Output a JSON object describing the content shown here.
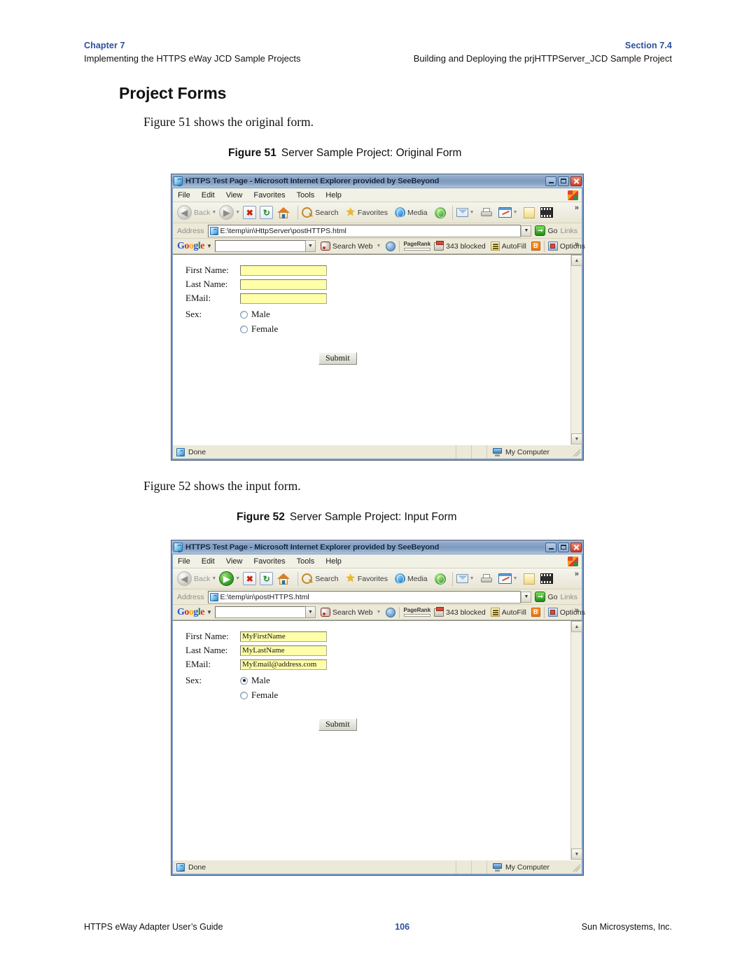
{
  "header": {
    "left_top": "Chapter 7",
    "left_sub": "Implementing the HTTPS eWay JCD Sample Projects",
    "right_top": "Section 7.4",
    "right_sub": "Building and Deploying the prjHTTPServer_JCD Sample Project",
    "accent_color": "#2a4f9e"
  },
  "section": {
    "title": "Project Forms",
    "para1": "Figure 51 shows the original form.",
    "para2": "Figure 52 shows the input form."
  },
  "figure51": {
    "caption_label": "Figure 51",
    "caption_text": "Server Sample Project: Original Form",
    "window": {
      "title": "HTTPS Test Page - Microsoft Internet Explorer provided by SeeBeyond",
      "minimize": "–",
      "maximize": "❐",
      "close": "✕",
      "menu": [
        "File",
        "Edit",
        "View",
        "Favorites",
        "Tools",
        "Help"
      ],
      "toolbar": {
        "back": "Back",
        "search": "Search",
        "favorites": "Favorites",
        "media": "Media",
        "overflow": "»"
      },
      "address": {
        "label": "Address",
        "value": "E:\\temp\\in\\HttpServer\\postHTTPS.html",
        "go": "Go",
        "links": "Links"
      },
      "google": {
        "logo": "Google",
        "query": "",
        "search_web": "Search Web",
        "pagerank": "PageRank",
        "blocked": "343 blocked",
        "autofill": "AutoFill",
        "b_button": "B",
        "options": "Options",
        "overflow": "»"
      },
      "status": {
        "text": "Done",
        "zone": "My Computer"
      }
    },
    "form": {
      "first_name_label": "First Name:",
      "first_name_value": "",
      "last_name_label": "Last Name:",
      "last_name_value": "",
      "email_label": "EMail:",
      "email_value": "",
      "sex_label": "Sex:",
      "male_label": "Male",
      "female_label": "Female",
      "male_checked": false,
      "female_checked": false,
      "submit_label": "Submit",
      "field_color": "#ffffaa"
    }
  },
  "figure52": {
    "caption_label": "Figure 52",
    "caption_text": "Server Sample Project: Input Form",
    "window": {
      "title": "HTTPS Test Page - Microsoft Internet Explorer provided by SeeBeyond",
      "menu": [
        "File",
        "Edit",
        "View",
        "Favorites",
        "Tools",
        "Help"
      ],
      "toolbar": {
        "back": "Back",
        "search": "Search",
        "favorites": "Favorites",
        "media": "Media",
        "overflow": "»"
      },
      "address": {
        "label": "Address",
        "value": "E:\\temp\\in\\postHTTPS.html",
        "go": "Go",
        "links": "Links"
      },
      "google": {
        "logo": "Google",
        "query": "",
        "search_web": "Search Web",
        "pagerank": "PageRank",
        "blocked": "343 blocked",
        "autofill": "AutoFill",
        "b_button": "B",
        "options": "Options",
        "overflow": "»"
      },
      "status": {
        "text": "Done",
        "zone": "My Computer"
      }
    },
    "form": {
      "first_name_label": "First Name:",
      "first_name_value": "MyFirstName",
      "last_name_label": "Last Name:",
      "last_name_value": "MyLastName",
      "email_label": "EMail:",
      "email_value": "MyEmail@address.com",
      "sex_label": "Sex:",
      "male_label": "Male",
      "female_label": "Female",
      "male_checked": true,
      "female_checked": false,
      "submit_label": "Submit",
      "field_color": "#ffffaa"
    }
  },
  "footer": {
    "left": "HTTPS eWay Adapter User’s Guide",
    "page_number": "106",
    "right": "Sun Microsystems, Inc."
  }
}
